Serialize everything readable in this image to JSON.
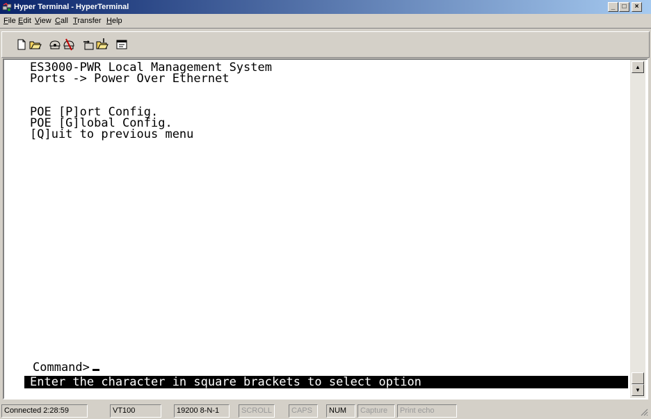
{
  "window": {
    "title": "Hyper Terminal - HyperTerminal",
    "controls": {
      "minimize": "_",
      "maximize": "□",
      "close": "×"
    }
  },
  "menu": [
    {
      "underline": "F",
      "rest": "ile"
    },
    {
      "underline": "E",
      "rest": "dit"
    },
    {
      "underline": "V",
      "rest": "iew"
    },
    {
      "underline": "C",
      "rest": "all"
    },
    {
      "underline": "T",
      "rest": "ransfer"
    },
    {
      "underline": "H",
      "rest": "elp"
    }
  ],
  "toolbar": {
    "buttons": [
      "new-icon",
      "open-icon",
      "connect-icon",
      "disconnect-icon",
      "send-icon",
      "receive-icon",
      "properties-icon"
    ]
  },
  "terminal": {
    "lines": [
      "ES3000-PWR Local Management System",
      "Ports -> Power Over Ethernet",
      "",
      "",
      "POE [P]ort Config.",
      "POE [G]lobal Config.",
      "[Q]uit to previous menu"
    ],
    "prompt": "Command>",
    "status_message": "Enter the character in square brackets to select option"
  },
  "statusbar": {
    "connected": "Connected 2:28:59",
    "emulation": "VT100",
    "settings": "19200 8-N-1",
    "scroll": "SCROLL",
    "caps": "CAPS",
    "num": "NUM",
    "capture": "Capture",
    "print_echo": "Print echo"
  },
  "colors": {
    "titlebar_start": "#0a246a",
    "titlebar_end": "#a6caf0",
    "chrome": "#d4d0c8",
    "terminal_bg": "#ffffff",
    "status_line_bg": "#000000"
  }
}
